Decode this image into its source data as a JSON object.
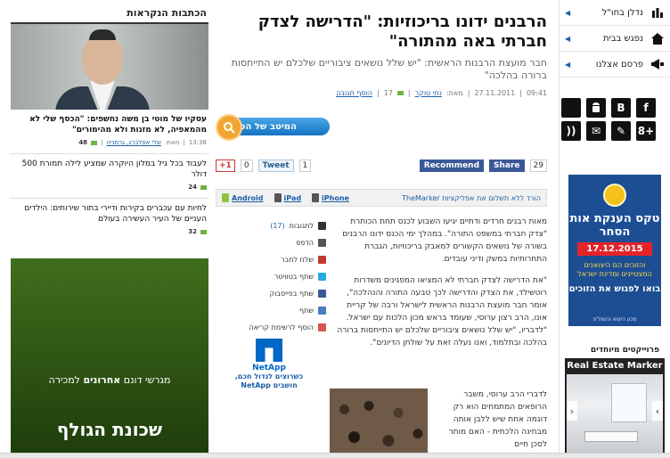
{
  "nav": {
    "items": [
      {
        "label": "נדלן בחו\"ל",
        "icon": "bar-chart-icon"
      },
      {
        "label": "נפגש בבית",
        "icon": "home-icon"
      },
      {
        "label": "פרסם אצלנו",
        "icon": "megaphone-icon"
      }
    ],
    "social": [
      "f",
      "B",
      "",
      "",
      "8+",
      "✎",
      "✉",
      "))"
    ]
  },
  "banner": {
    "title": "טקס הענקת אות הסחר",
    "date": "17.12.2015",
    "text": "והזוכים הם היצואנים המצטיינים ומדינת ישראל",
    "cta": "בואו לפגוש את הזוכים",
    "footer": "מכון היצוא והשת\"פ"
  },
  "projects_label": "פרוייקטים מיוחדים",
  "real_estate": {
    "title": "Real Estate Marker"
  },
  "article": {
    "headline": "הרבנים ידונו בריכוזיות: \"הדרישה לצדק חברתי באה מהתורה\"",
    "subhead": "חבר מועצת הרבנות הראשית: \"יש שלל נושאים ציבוריים שלכלם יש התייחסות ברורה בהלכה\"",
    "meta": {
      "time": "09:41",
      "date": "27.11.2011",
      "by": "מאת:",
      "author": "נתי טוקר",
      "count": "17",
      "add_comment": "הוסף תגובה"
    },
    "best_button": "המיטב של הכתבה",
    "share": {
      "gplus": "+1",
      "tweet": "Tweet",
      "tweet_count": "1",
      "fb_recommend": "Recommend",
      "fb_share": "Share",
      "fb_count": "29"
    },
    "apps": {
      "text": "הורד ללא תשלום את אפליקציות TheMarker",
      "iphone": "iPhone",
      "ipad": "iPad",
      "android": "Android"
    },
    "paragraphs": [
      "מאות רבנים חרדים ודתיים יגיעו השבוע לכנס תחת הכותרת \"צדק חברתי במשפט התורה\". במהלך ימי הכנס ידונו הרבנים בשורה של נושאים הקשורים למאבק בריכוזיות, הגברת התחרותיות במשק ודיני עובדים.",
      "\"את הדרישה לצדק חברתי לא המציאו המפגינים משדרות רוטשילד, את הצדק והדרישה לכך טבעה התורה והנהלכה\", אומר חבר מועצת הרבנות הראשית לישראל ורבה של קריית אונו, הרב רצון ערוסי, שעומד בראש מכון הלכות עם ישראל. \"לדבריו, \"יש שלל נושאים ציבוריים שלכלם יש התייחסות ברורה בהלכה ובתלמוד, ואנו נעלה זאת על שולחן הדיונים\"."
    ],
    "img_text": "לדברי הרב ערוסי, משבר הרופאים המתמחים הוא רק דוגמה אחת שיש ללבן אותה מבחינה הלכתית - האם מותר לסכן חיים",
    "tools": [
      {
        "label": "לתגובות",
        "count": "(17)"
      },
      {
        "label": "הדפס"
      },
      {
        "label": "שלח לחבר"
      },
      {
        "label": "שתף בטוויטר"
      },
      {
        "label": "שתף בפייסבוק"
      },
      {
        "label": "שתף"
      },
      {
        "label": "הוסף לרשימת קריאה"
      }
    ],
    "netapp": {
      "name": "NetApp",
      "tag": "כשרוצים לגדול חכם, חושבים NetApp"
    }
  },
  "left": {
    "header": "הכתבות הנקראות",
    "stories": [
      {
        "title": "עסקיו של מוטי בן משה נחשפים: \"הכסף שלי לא מהמאפיה, לא מזנות ולא מהימורים\"",
        "time": "13:38",
        "by": "מאת:",
        "author": "שלי אפלברג, גרמניה",
        "count": "48"
      },
      {
        "title": "לעבוד בכל גיל במלון היוקרה שמציע לילה תמורת 500 דולר",
        "count": "24"
      },
      {
        "title": "לחיות עם עכברים בקירות ודיירי בתור שירותים: הילדים העניים של העיר העשירה בעולם",
        "count": "32"
      }
    ],
    "ad": {
      "line1_pre": "מגרשי דונם",
      "line1_bold": "אחרונים",
      "line1_post": "למכירה",
      "line2": "שכונת הגולף"
    }
  }
}
